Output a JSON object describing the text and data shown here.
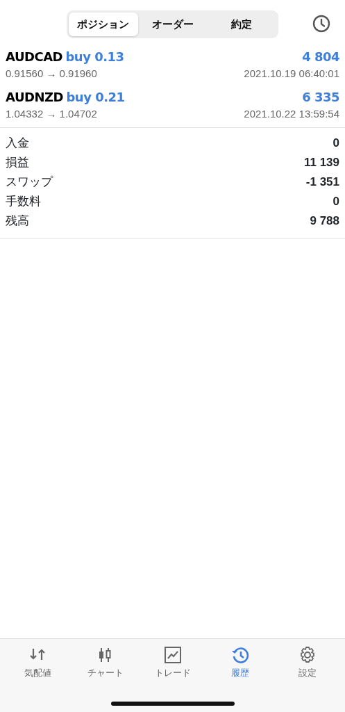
{
  "segments": [
    {
      "label": "ポジション",
      "selected": true
    },
    {
      "label": "オーダー",
      "selected": false
    },
    {
      "label": "約定",
      "selected": false
    }
  ],
  "deals": [
    {
      "symbol": "AUDCAD",
      "side": "buy 0.13",
      "profit": "4 804",
      "prices": "0.91560 → 0.91960",
      "time": "2021.10.19 06:40:01"
    },
    {
      "symbol": "AUDNZD",
      "side": "buy 0.21",
      "profit": "6 335",
      "prices": "1.04332 → 1.04702",
      "time": "2021.10.22 13:59:54"
    }
  ],
  "summary": [
    {
      "label": "入金",
      "value": "0"
    },
    {
      "label": "損益",
      "value": "11 139"
    },
    {
      "label": "スワップ",
      "value": "-1 351"
    },
    {
      "label": "手数料",
      "value": "0"
    },
    {
      "label": "残高",
      "value": "9 788"
    }
  ],
  "tab_bar": [
    {
      "kind": "quotes",
      "label": "気配値",
      "selected": false
    },
    {
      "kind": "chart",
      "label": "チャート",
      "selected": false
    },
    {
      "kind": "trade",
      "label": "トレード",
      "selected": false
    },
    {
      "kind": "history",
      "label": "履歴",
      "selected": true
    },
    {
      "kind": "settings",
      "label": "設定",
      "selected": false
    }
  ]
}
